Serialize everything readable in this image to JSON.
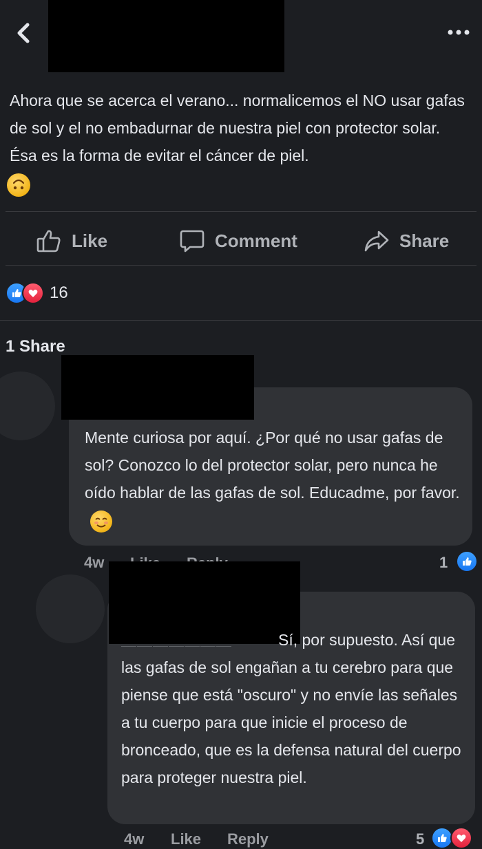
{
  "header": {
    "back_glyph": "‹",
    "more_glyph": "•••"
  },
  "post": {
    "text": "Ahora que se acerca el verano... normalicemos el NO usar gafas de sol y el no embadurnar de nuestra piel con protector solar. Ésa es la forma de evitar el cáncer de piel.",
    "emoji": "upside-down-face-emoji"
  },
  "actions": {
    "like_label": "Like",
    "comment_label": "Comment",
    "share_label": "Share"
  },
  "reactions": {
    "types": [
      "like",
      "love"
    ],
    "count": "16"
  },
  "shares": {
    "label": "1 Share"
  },
  "comments": [
    {
      "text": "Mente curiosa por aquí. ¿Por qué no usar gafas de sol? Conozco lo del protector solar, pero nunca he oído hablar de las gafas de sol. Educadme, por favor.",
      "emoji": "smiling-face-emoji",
      "time": "4w",
      "like": "Like",
      "reply": "Reply",
      "reaction_count": "1"
    },
    {
      "text": "Sí, por supuesto. Así que las gafas de sol engañan a tu cerebro para que piense que está \"oscuro\" y no envíe las señales a tu cuerpo para que inicie el proceso de bronceado, que es la defensa natural del cuerpo para proteger nuestra piel.",
      "time": "4w",
      "like": "Like",
      "reply": "Reply",
      "reaction_count": "5"
    }
  ],
  "colors": {
    "background": "#1c1e22",
    "bubble": "#303236",
    "text": "#e4e6eb",
    "muted": "#b0b3b8",
    "like_blue": "#1877f2",
    "love_red": "#e4223d"
  }
}
